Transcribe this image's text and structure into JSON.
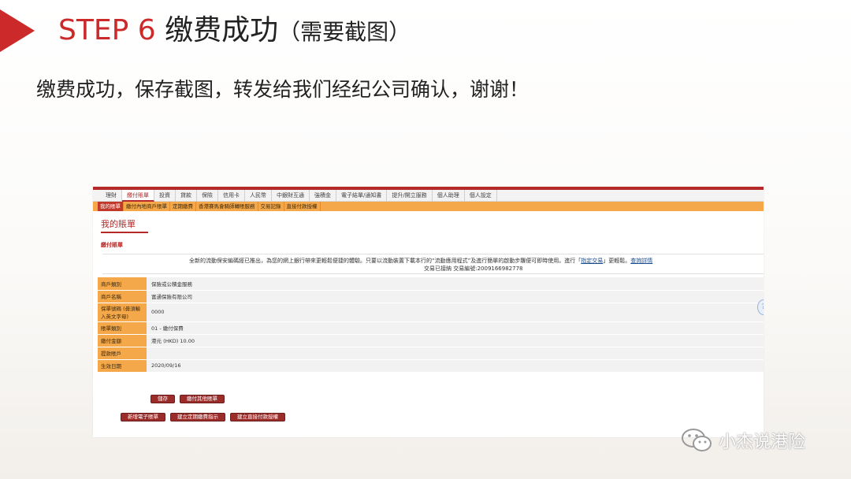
{
  "slide": {
    "step_label": "STEP 6",
    "title": "缴费成功",
    "title_note": "（需要截图）",
    "subtitle": "缴费成功，保存截图，转发给我们经纪公司确认，谢谢！",
    "accent_color": "#cc2a2a"
  },
  "screenshot": {
    "top_nav": [
      "理財",
      "繳付賬單",
      "投資",
      "貸款",
      "保險",
      "信用卡",
      "人民幣",
      "中銀財互通",
      "強積金",
      "電子結單/通知書",
      "提升/開立服務",
      "個人助理",
      "個人設定"
    ],
    "top_nav_active": "繳付賬單",
    "sub_nav": [
      "我的賬單",
      "繳付內地商戶賬單",
      "定期繳費",
      "香港賽馬會騎師轉賬服務",
      "交易記錄",
      "直接付款授權"
    ],
    "sub_nav_active": "我的賬單",
    "page_heading": "我的賬單",
    "section_heading": "繳付賬單",
    "notice": {
      "line1_pre": "全新的流動保安編碼經已推出，為您的網上銀行帶來更輕鬆便捷的體驗。只要以流動裝置下載本行的“流動應用程式”及進行簡單的啟動步驟便可即時使用。進行「",
      "line1_link1": "指定交易",
      "line1_mid": "」更輕鬆。",
      "line1_link2": "查詢詳情",
      "line2": "交易已接納 交易編號:2009166982778"
    },
    "details": [
      {
        "key": "商戶類別",
        "value": "保險或公積金服務"
      },
      {
        "key": "商戶名稱",
        "value": "富通保險有限公司"
      },
      {
        "key": "保單號碼 (毋須輸入英文字母)",
        "value": "0000"
      },
      {
        "key": "賬單類別",
        "value": "01 - 繳付保費"
      },
      {
        "key": "繳付金額",
        "value": "港元 (HKD) 10.00"
      },
      {
        "key": "提款賬戶",
        "value": ""
      },
      {
        "key": "生效日期",
        "value": "2020/09/16"
      }
    ],
    "buttons_row1": [
      "儲存",
      "繳付其他賬單"
    ],
    "buttons_row2": [
      "新增電子賬單",
      "建立定期繳費指示",
      "建立直接付款授權"
    ],
    "brand_color": "#b52a28",
    "subnav_color": "#f5a84a"
  },
  "watermark": {
    "text": "小杰说港险",
    "icon": "wechat-icon"
  }
}
